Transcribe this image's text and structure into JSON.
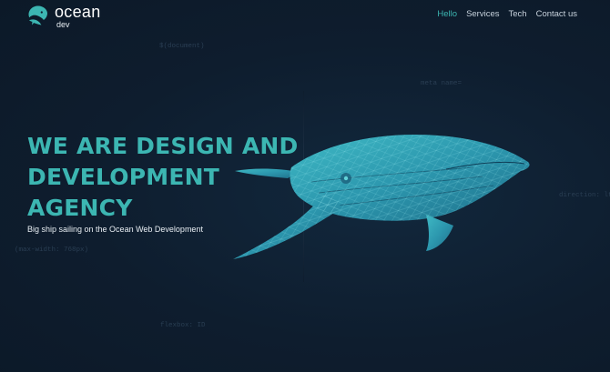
{
  "brand": {
    "name": "ocean",
    "sub": "dev",
    "icon": "whale-logo-icon",
    "accent": "#3cb6b2"
  },
  "nav": {
    "items": [
      {
        "label": "Hello",
        "active": true
      },
      {
        "label": "Services",
        "active": false
      },
      {
        "label": "Tech",
        "active": false
      },
      {
        "label": "Contact us",
        "active": false
      }
    ]
  },
  "background_labels": {
    "body": "$(document)",
    "meta": "meta name=",
    "direction": "direction: ltr",
    "media": "(max-width: 768px)",
    "flexbox": "flexbox: ID"
  },
  "hero": {
    "title_line1": "WE ARE DESIGN AND",
    "title_line2": "DEVELOPMENT",
    "title_line3": "AGENCY",
    "subtitle": "Big ship sailing on the Ocean Web Development",
    "illustration": "low-poly-whale-illustration"
  },
  "colors": {
    "background": "#0e1d2e",
    "accent": "#3cb6b2",
    "whale": "#2f9fb3"
  }
}
